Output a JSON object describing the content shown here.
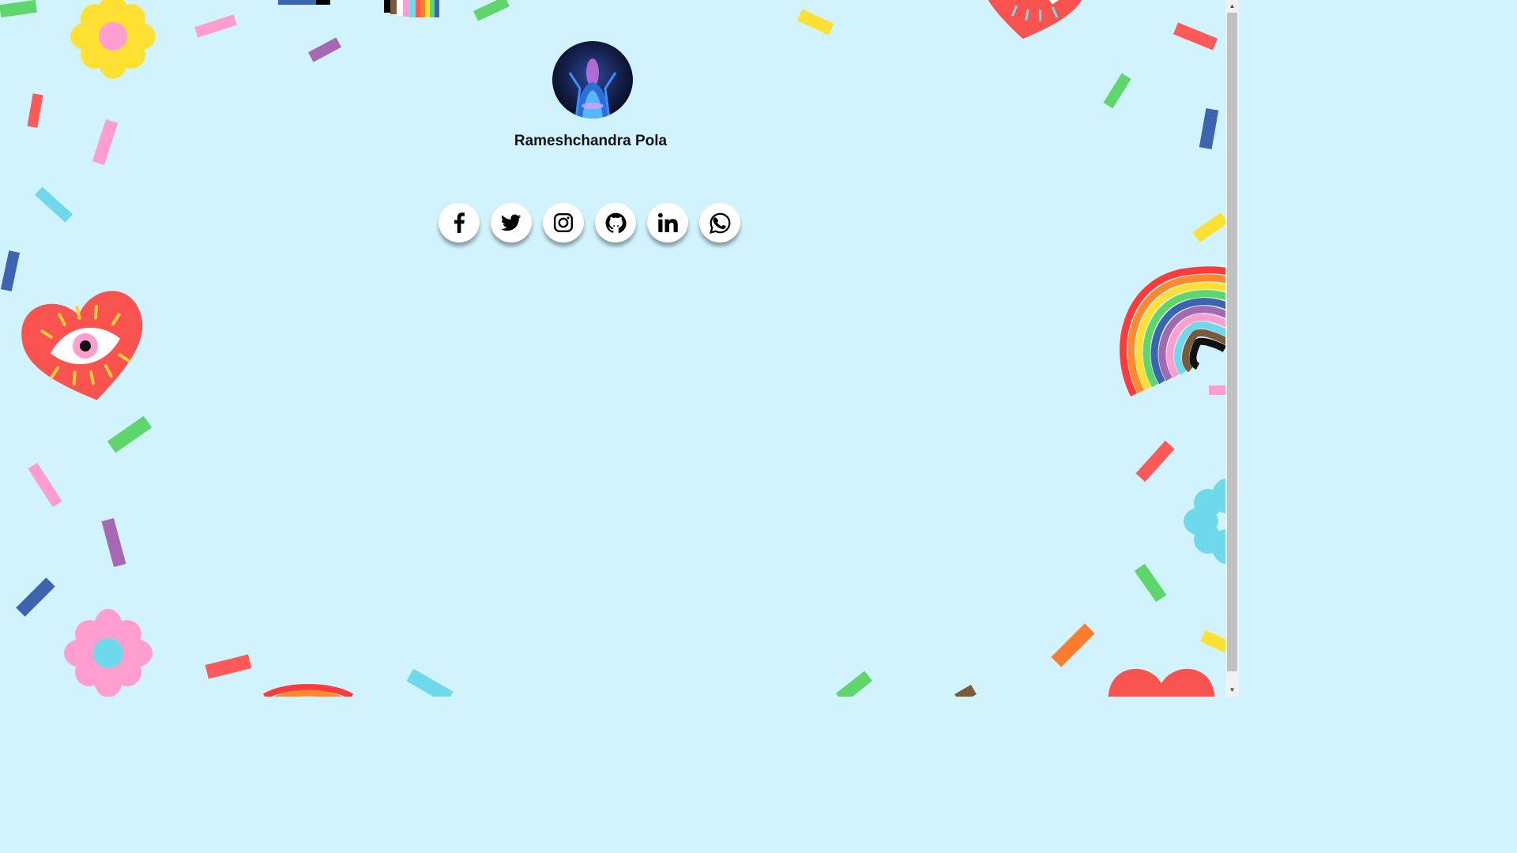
{
  "profile": {
    "name": "Rameshchandra Pola"
  },
  "social_links": [
    {
      "icon": "facebook-icon"
    },
    {
      "icon": "twitter-icon"
    },
    {
      "icon": "instagram-icon"
    },
    {
      "icon": "github-icon"
    },
    {
      "icon": "linkedin-icon"
    },
    {
      "icon": "whatsapp-icon"
    }
  ],
  "colors": {
    "background": "#d1f3fd",
    "button_bg": "#ffffff",
    "icon": "#000000",
    "confetti": [
      "#ff5a5a",
      "#ff9ecf",
      "#ffe033",
      "#5ed66b",
      "#6fd9ec",
      "#a669b1",
      "#3c64b1",
      "#ff7b2e"
    ]
  },
  "scrollbar": {
    "up_arrow": "▲",
    "down_arrow": "▼"
  }
}
